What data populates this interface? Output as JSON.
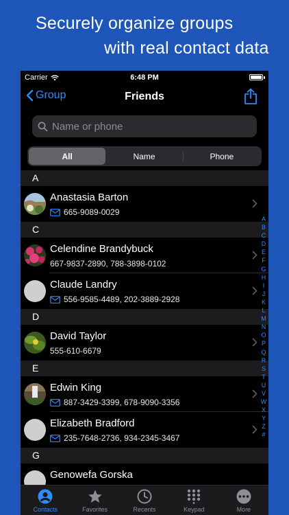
{
  "promo": {
    "line1": "Securely organize groups",
    "line2": "with real contact data"
  },
  "status_bar": {
    "carrier": "Carrier",
    "time": "6:48 PM"
  },
  "nav": {
    "back_label": "Group",
    "title": "Friends"
  },
  "search": {
    "placeholder": "Name or phone"
  },
  "segment": {
    "options": [
      "All",
      "Name",
      "Phone"
    ],
    "selected": "All"
  },
  "sections": [
    {
      "letter": "A",
      "contacts": [
        {
          "name": "Anastasia Barton",
          "detail": "665-9089-0029",
          "has_mail_icon": true,
          "avatar": "landscape-photo"
        }
      ]
    },
    {
      "letter": "C",
      "contacts": [
        {
          "name": "Celendine Brandybuck",
          "detail": "667-9837-2890, 788-3898-0102",
          "has_mail_icon": false,
          "avatar": "flower-photo"
        },
        {
          "name": "Claude Landry",
          "detail": "556-9585-4489, 202-3889-2928",
          "has_mail_icon": true,
          "avatar": "placeholder"
        }
      ]
    },
    {
      "letter": "D",
      "contacts": [
        {
          "name": "David Taylor",
          "detail": "555-610-6679",
          "has_mail_icon": false,
          "avatar": "plant-photo"
        }
      ]
    },
    {
      "letter": "E",
      "contacts": [
        {
          "name": "Edwin King",
          "detail": "887-3429-3399, 678-9090-3356",
          "has_mail_icon": true,
          "avatar": "waterfall-photo"
        },
        {
          "name": "Elizabeth Bradford",
          "detail": "235-7648-2736, 934-2345-3467",
          "has_mail_icon": true,
          "avatar": "placeholder"
        }
      ]
    },
    {
      "letter": "G",
      "contacts": [
        {
          "name": "Genowefa Gorska",
          "detail": "",
          "has_mail_icon": false,
          "avatar": "placeholder"
        }
      ]
    }
  ],
  "index_letters": [
    "A",
    "B",
    "C",
    "D",
    "E",
    "F",
    "G",
    "H",
    "I",
    "J",
    "K",
    "L",
    "M",
    "N",
    "O",
    "P",
    "Q",
    "R",
    "S",
    "T",
    "U",
    "V",
    "W",
    "X",
    "Y",
    "Z",
    "#"
  ],
  "tabs": [
    {
      "label": "Contacts",
      "icon": "person-circle-icon",
      "active": true
    },
    {
      "label": "Favorites",
      "icon": "star-icon",
      "active": false
    },
    {
      "label": "Recents",
      "icon": "clock-icon",
      "active": false
    },
    {
      "label": "Keypad",
      "icon": "keypad-icon",
      "active": false
    },
    {
      "label": "More",
      "icon": "more-icon",
      "active": false
    }
  ],
  "colors": {
    "background": "#1d56b8",
    "accent": "#2f8bff",
    "screen": "#000000"
  }
}
